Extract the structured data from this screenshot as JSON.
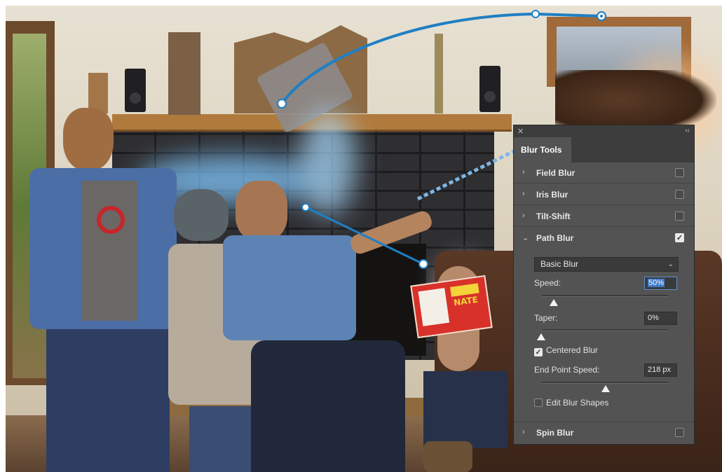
{
  "scene": {
    "book_title": "NATE"
  },
  "panel": {
    "close_glyph": "✕",
    "collapse_glyph": "‹‹",
    "tab_label": "Blur Tools",
    "sections": [
      {
        "label": "Field Blur",
        "checked": false
      },
      {
        "label": "Iris Blur",
        "checked": false
      },
      {
        "label": "Tilt-Shift",
        "checked": false
      },
      {
        "label": "Path Blur",
        "checked": true
      },
      {
        "label": "Spin Blur",
        "checked": false
      }
    ],
    "path_blur": {
      "mode_value": "Basic Blur",
      "speed_label": "Speed:",
      "speed_value": "50%",
      "taper_label": "Taper:",
      "taper_value": "0%",
      "centered_blur_label": "Centered Blur",
      "centered_blur_checked": true,
      "end_point_speed_label": "End Point Speed:",
      "end_point_speed_value": "218 px",
      "edit_blur_shapes_label": "Edit Blur Shapes",
      "edit_blur_shapes_checked": false
    }
  },
  "colors": {
    "path_stroke": "#1f7fc4",
    "panel_bg": "#535353",
    "panel_header": "#3d3d3d",
    "highlight": "#3f79c7"
  }
}
